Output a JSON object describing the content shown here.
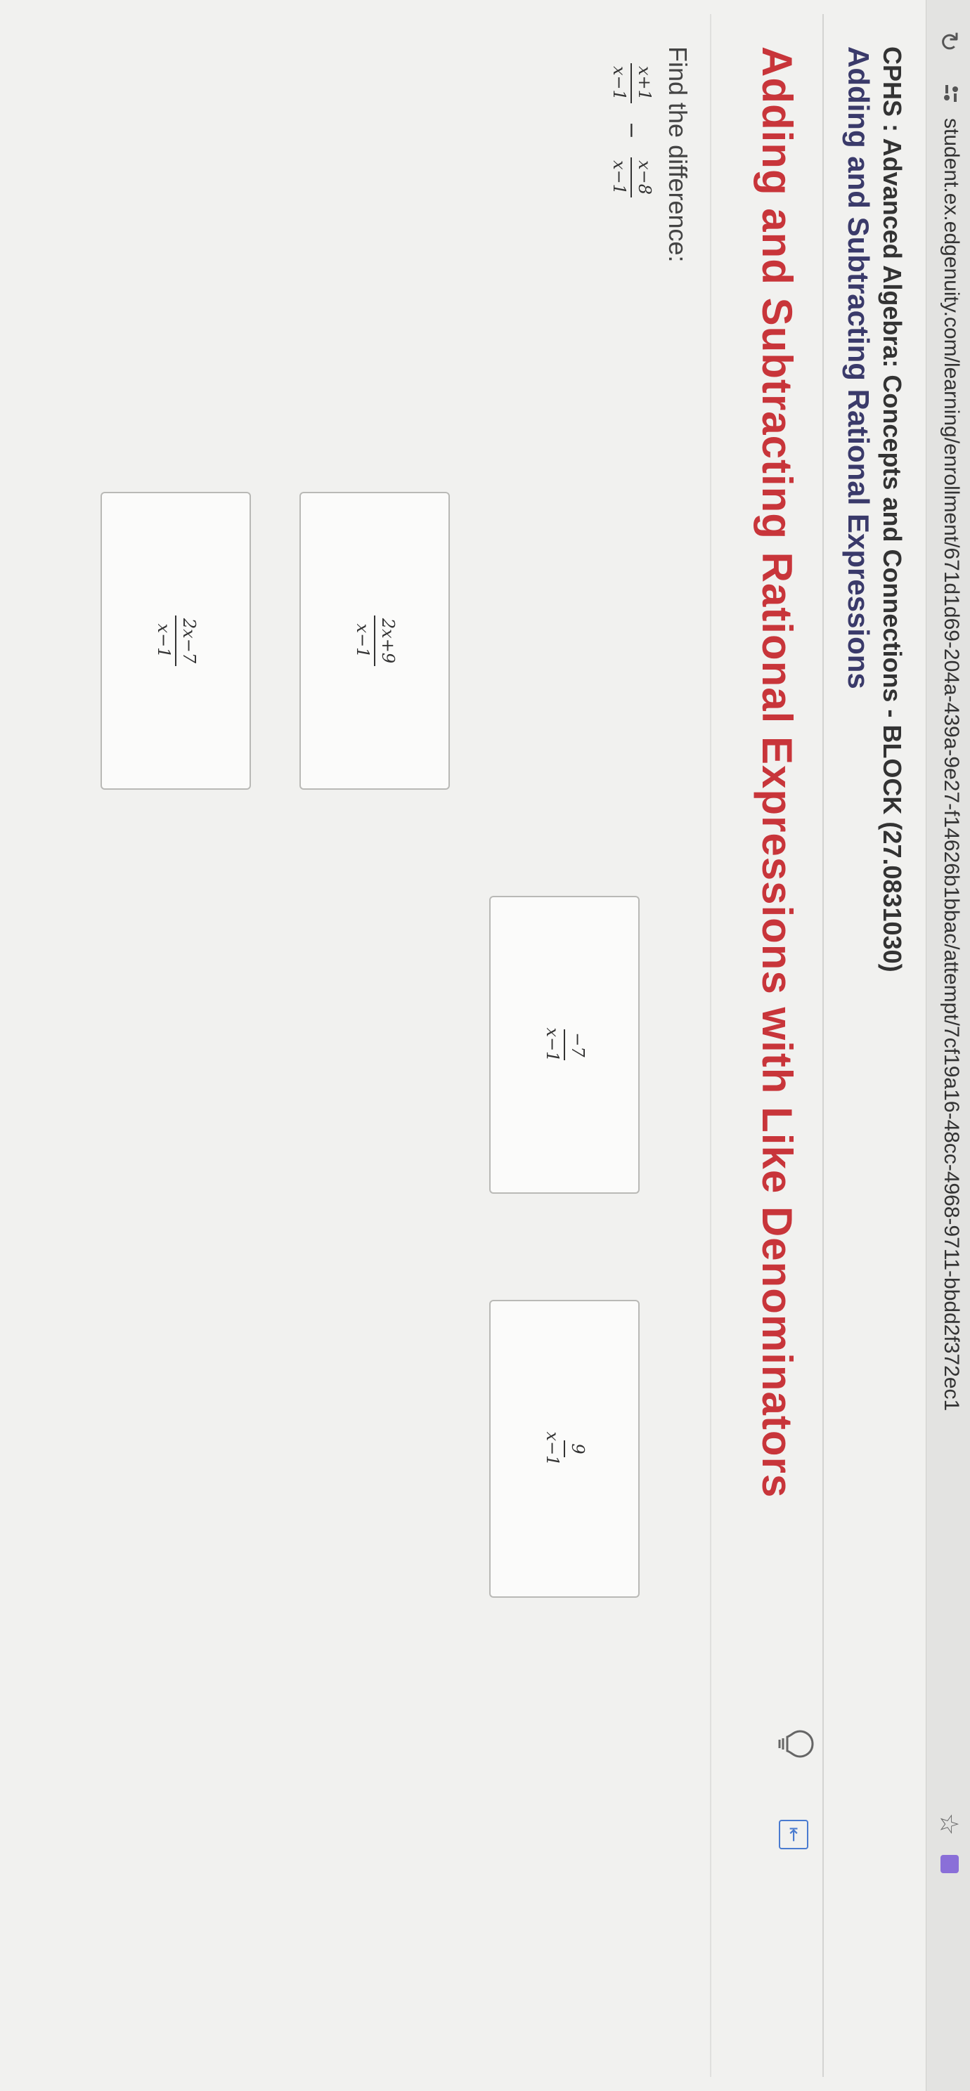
{
  "browser": {
    "url": "student.ex.edgenuity.com/learning/enrollment/671d1d69-204a-439a-9e27-f14626b1bbac/attempt/7cf19a16-48cc-4968-9711-bbdd2f372ec1"
  },
  "header": {
    "course_title": "CPHS : Advanced Algebra: Concepts and Connections - BLOCK (27.0831030)",
    "lesson_title": "Adding and Subtracting Rational Expressions"
  },
  "activity": {
    "title": "Adding and Subtracting Rational Expressions with Like Denominators"
  },
  "question": {
    "prompt": "Find the difference:",
    "term1": {
      "num": "x+1",
      "den": "x−1"
    },
    "operator": "−",
    "term2": {
      "num": "x−8",
      "den": "x−1"
    }
  },
  "answers": [
    {
      "num": "2x+9",
      "den": "x−1"
    },
    {
      "num": "2x−7",
      "den": "x−1"
    },
    {
      "num": "−7",
      "den": "x−1"
    },
    {
      "num": "9",
      "den": "x−1"
    }
  ],
  "icons": {
    "refresh": "refresh-icon",
    "site": "site-settings-icon",
    "star": "bookmark-star-icon",
    "extension": "extension-icon",
    "hint": "lightbulb-icon",
    "expand": "expand-icon"
  }
}
